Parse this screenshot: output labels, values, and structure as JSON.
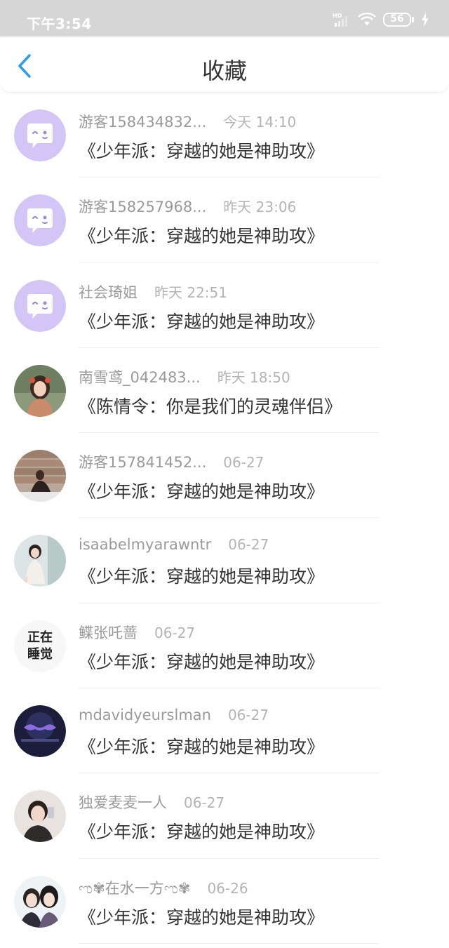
{
  "status_bar": {
    "time": "下午3:54",
    "network": "HD",
    "battery_level": "56",
    "icons": [
      "signal-icon",
      "wifi-icon",
      "battery-icon",
      "charging-icon"
    ]
  },
  "header": {
    "title": "收藏",
    "back_icon": "chevron-left-icon",
    "accent_color": "#2e9bf0"
  },
  "favorites": [
    {
      "user": "游客158434832...",
      "time": "今天 14:10",
      "title": "《少年派：穿越的她是神助攻》",
      "avatar": "default-chat-avatar"
    },
    {
      "user": "游客158257968...",
      "time": "昨天 23:06",
      "title": "《少年派：穿越的她是神助攻》",
      "avatar": "default-chat-avatar"
    },
    {
      "user": "社会琦姐",
      "time": "昨天 22:51",
      "title": "《少年派：穿越的她是神助攻》",
      "avatar": "default-chat-avatar"
    },
    {
      "user": "南雪鸢_042483...",
      "time": "昨天 18:50",
      "title": "《陈情令：你是我们的灵魂伴侣》",
      "avatar": "photo-avatar"
    },
    {
      "user": "游客157841452...",
      "time": "06-27",
      "title": "《少年派：穿越的她是神助攻》",
      "avatar": "photo-avatar"
    },
    {
      "user": "isaabelmyarawntr",
      "time": "06-27",
      "title": "《少年派：穿越的她是神助攻》",
      "avatar": "photo-avatar"
    },
    {
      "user": "鲽张吒蔷",
      "time": "06-27",
      "title": "《少年派：穿越的她是神助攻》",
      "avatar": "text-avatar",
      "avatar_text": [
        "正在",
        "睡觉"
      ]
    },
    {
      "user": "mdavidyeurslman",
      "time": "06-27",
      "title": "《少年派：穿越的她是神助攻》",
      "avatar": "photo-avatar"
    },
    {
      "user": "独爱麦麦一人",
      "time": "06-27",
      "title": "《少年派：穿越的她是神助攻》",
      "avatar": "photo-avatar"
    },
    {
      "user": "ಌ✾在水一方ಌ✾",
      "time": "06-26",
      "title": "《少年派：穿越的她是神助攻》",
      "avatar": "photo-avatar"
    }
  ],
  "colors": {
    "default_avatar": "#d3c5f5",
    "username": "#9a9a9a",
    "timestamp": "#b4b4b4",
    "title_text": "#333333",
    "status_bar": "#d6d6d6"
  }
}
